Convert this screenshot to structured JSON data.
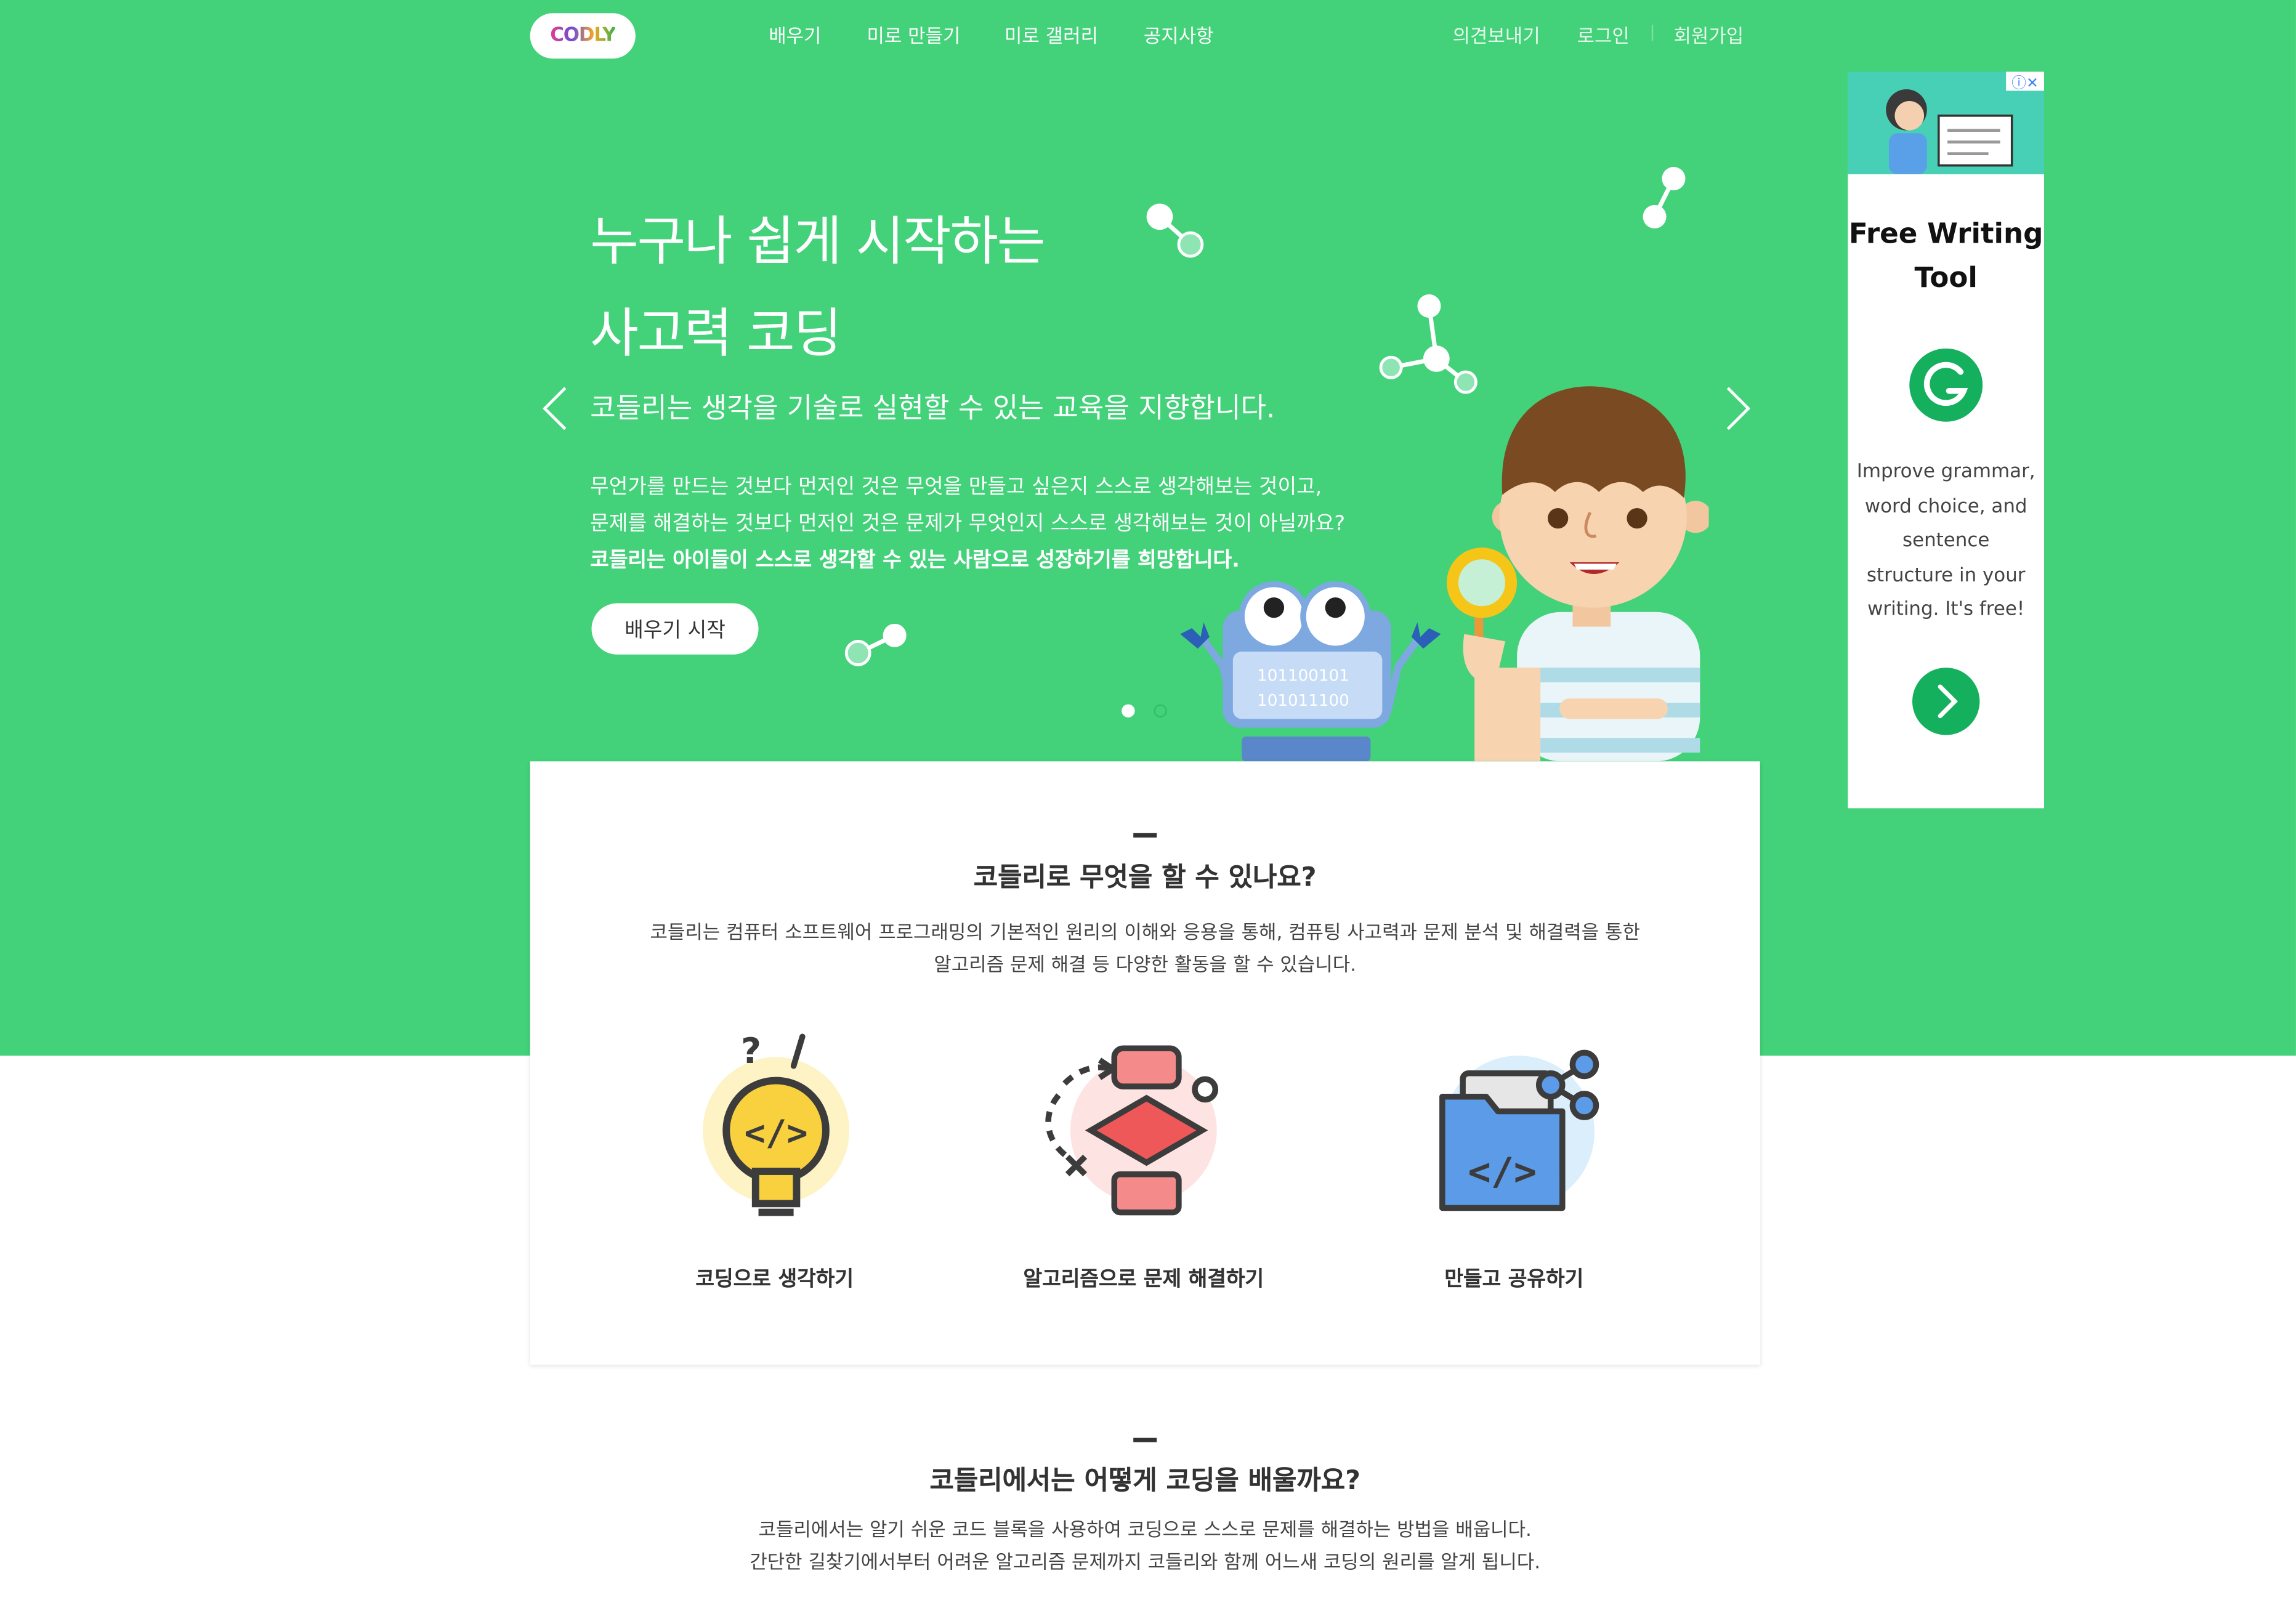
{
  "header": {
    "logo_text": "CODLY",
    "nav": [
      "배우기",
      "미로 만들기",
      "미로 갤러리",
      "공지사항"
    ],
    "feedback": "의견보내기",
    "login": "로그인",
    "signup": "회원가입"
  },
  "hero": {
    "title_line1": "누구나 쉽게 시작하는",
    "title_line2": "사고력 코딩",
    "subtitle": "코들리는 생각을 기술로 실현할 수 있는 교육을 지향합니다.",
    "para_line1": "무언가를 만드는 것보다 먼저인 것은 무엇을 만들고 싶은지 스스로 생각해보는 것이고,",
    "para_line2": "문제를 해결하는 것보다 먼저인 것은 문제가 무엇인지 스스로 생각해보는 것이 아닐까요?",
    "para_bold": "코들리는 아이들이 스스로 생각할 수 있는 사람으로 성장하기를 희망합니다.",
    "start_button": "배우기 시작",
    "prev_arrow": "‹",
    "next_arrow": "›",
    "robot_binary_1": "101100101",
    "robot_binary_2": "101011100",
    "slide_count": 2,
    "active_slide": 1
  },
  "section1": {
    "title": "코들리로 무엇을 할 수 있나요?",
    "desc_line1": "코들리는 컴퓨터 소프트웨어 프로그래밍의 기본적인 원리의 이해와 응용을 통해, 컴퓨팅 사고력과 문제 분석 및 해결력을 통한",
    "desc_line2": "알고리즘 문제 해결 등 다양한 활동을 할 수 있습니다.",
    "features": [
      {
        "label": "코딩으로 생각하기",
        "icon": "lightbulb-code-icon"
      },
      {
        "label": "알고리즘으로 문제 해결하기",
        "icon": "flowchart-icon"
      },
      {
        "label": "만들고 공유하기",
        "icon": "folder-share-icon"
      }
    ]
  },
  "section2": {
    "title": "코들리에서는 어떻게 코딩을 배울까요?",
    "desc_line1": "코들리에서는 알기 쉬운 코드 블록을 사용하여 코딩으로 스스로 문제를 해결하는 방법을 배웁니다.",
    "desc_line2": "간단한 길찾기에서부터 어려운 알고리즘 문제까지 코들리와 함께 어느새 코딩의 원리를 알게 됩니다."
  },
  "ad": {
    "title": "Free Writing Tool",
    "body": "Improve grammar, word choice, and sentence structure in your writing. It's free!",
    "badge": "ⓘ✕"
  },
  "colors": {
    "brand_green": "#43d17a",
    "ad_green": "#15b05e",
    "text_dark": "#333333"
  }
}
